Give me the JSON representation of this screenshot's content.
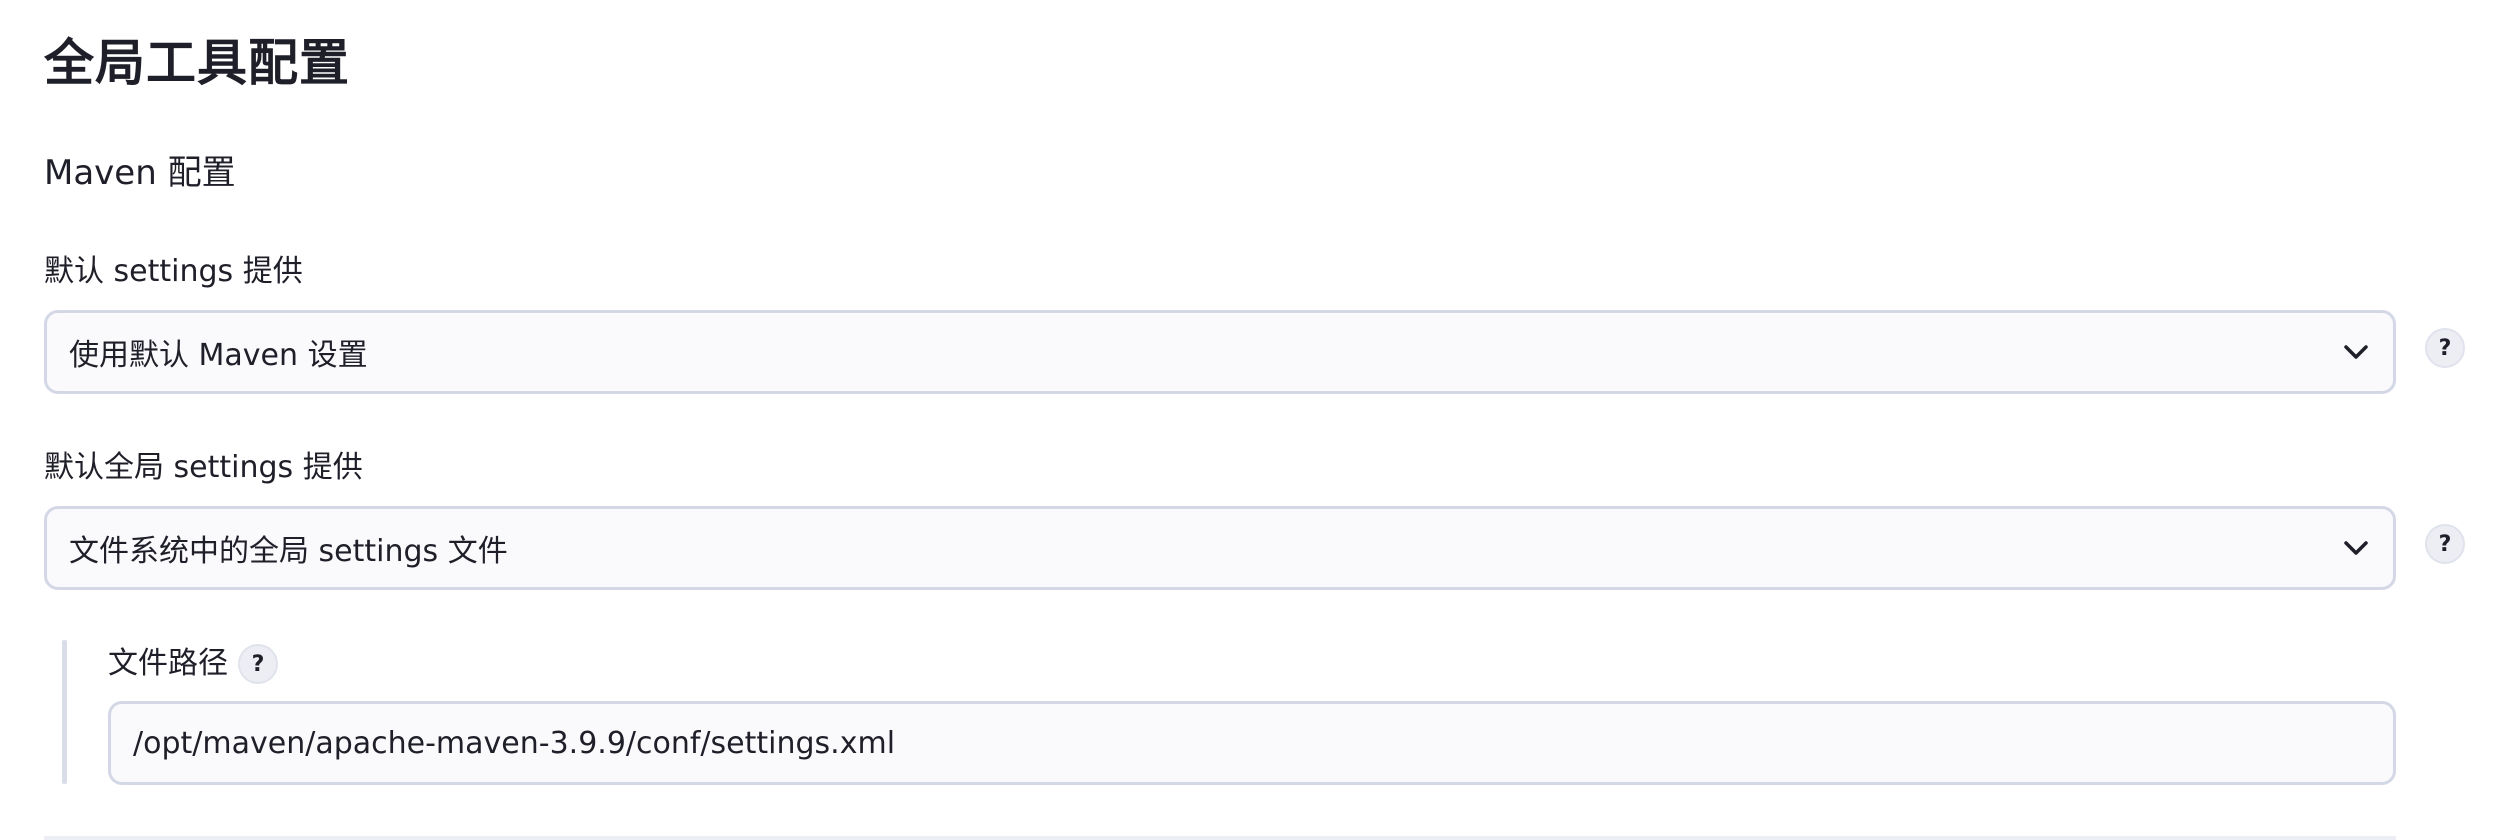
{
  "page": {
    "title": "全局工具配置"
  },
  "maven": {
    "section_title": "Maven 配置",
    "default_settings": {
      "label": "默认 settings 提供",
      "selected": "使用默认 Maven 设置",
      "help": "?"
    },
    "default_global_settings": {
      "label": "默认全局 settings 提供",
      "selected": "文件系统中的全局 settings 文件",
      "help": "?"
    },
    "file_path": {
      "label": "文件路径",
      "help": "?",
      "value": "/opt/maven/apache-maven-3.9.9/conf/settings.xml"
    }
  },
  "icons": {
    "dropdown": "chevron-down-icon",
    "help": "help-icon"
  }
}
